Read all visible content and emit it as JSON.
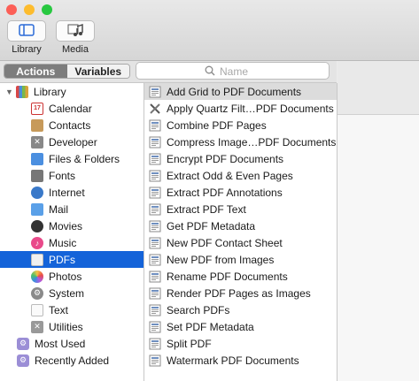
{
  "toolbar": {
    "library_label": "Library",
    "media_label": "Media"
  },
  "tabs": {
    "actions_label": "Actions",
    "variables_label": "Variables"
  },
  "search": {
    "placeholder": "Name",
    "value": ""
  },
  "library_tree": {
    "root_label": "Library",
    "items": [
      {
        "label": "Calendar",
        "icon": "calendar-icon"
      },
      {
        "label": "Contacts",
        "icon": "contacts-icon"
      },
      {
        "label": "Developer",
        "icon": "developer-tools-icon"
      },
      {
        "label": "Files & Folders",
        "icon": "finder-icon"
      },
      {
        "label": "Fonts",
        "icon": "fonts-icon"
      },
      {
        "label": "Internet",
        "icon": "globe-icon"
      },
      {
        "label": "Mail",
        "icon": "mail-icon"
      },
      {
        "label": "Movies",
        "icon": "movies-icon"
      },
      {
        "label": "Music",
        "icon": "music-icon"
      },
      {
        "label": "PDFs",
        "icon": "pdf-icon",
        "selected": true
      },
      {
        "label": "Photos",
        "icon": "photos-icon"
      },
      {
        "label": "System",
        "icon": "system-icon"
      },
      {
        "label": "Text",
        "icon": "text-icon"
      },
      {
        "label": "Utilities",
        "icon": "utilities-icon"
      }
    ],
    "most_used_label": "Most Used",
    "recently_added_label": "Recently Added"
  },
  "actions": [
    {
      "label": "Add Grid to PDF Documents",
      "highlighted": true
    },
    {
      "label": "Apply Quartz Filt…PDF Documents"
    },
    {
      "label": "Combine PDF Pages"
    },
    {
      "label": "Compress Image…PDF Documents"
    },
    {
      "label": "Encrypt PDF Documents"
    },
    {
      "label": "Extract Odd & Even Pages"
    },
    {
      "label": "Extract PDF Annotations"
    },
    {
      "label": "Extract PDF Text"
    },
    {
      "label": "Get PDF Metadata"
    },
    {
      "label": "New PDF Contact Sheet"
    },
    {
      "label": "New PDF from Images"
    },
    {
      "label": "Rename PDF Documents"
    },
    {
      "label": "Render PDF Pages as Images"
    },
    {
      "label": "Search PDFs"
    },
    {
      "label": "Set PDF Metadata"
    },
    {
      "label": "Split PDF"
    },
    {
      "label": "Watermark PDF Documents"
    }
  ],
  "colors": {
    "selection": "#1463d9",
    "close": "#fc5f57",
    "minimize": "#fdbc2e",
    "zoom": "#28c840"
  }
}
